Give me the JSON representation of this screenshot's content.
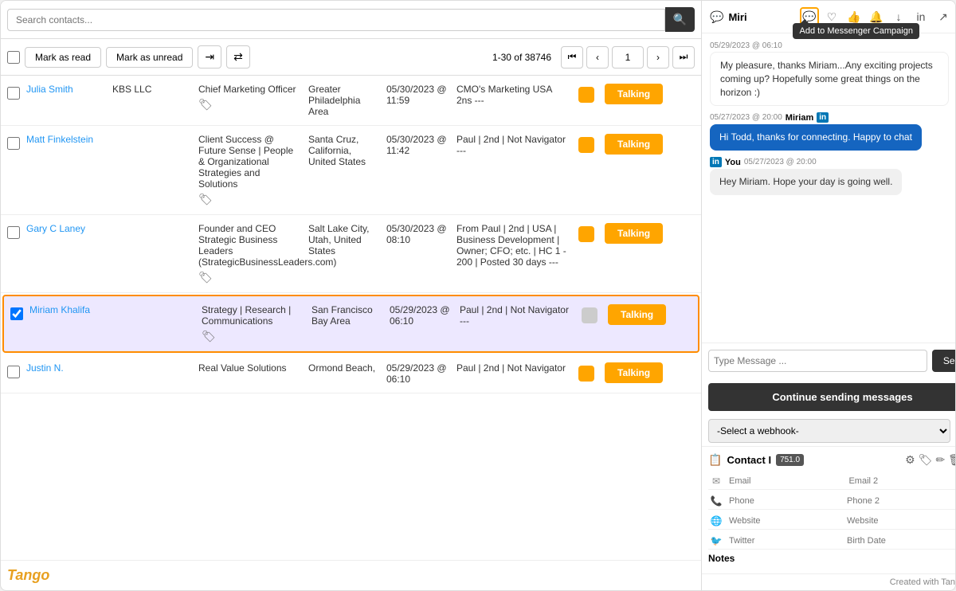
{
  "search": {
    "placeholder": "Search contacts...",
    "value": ""
  },
  "toolbar": {
    "mark_read": "Mark as read",
    "mark_unread": "Mark as unread",
    "pagination_info": "1-30 of 38746",
    "page_current": "1"
  },
  "contacts": [
    {
      "name": "Julia Smith",
      "company": "KBS LLC",
      "title": "Chief Marketing Officer",
      "location": "Greater Philadelphia Area",
      "date": "05/30/2023 @ 11:59",
      "message": "CMO's Marketing USA 2ns ---",
      "status": "orange",
      "action": "Talking",
      "tag": true,
      "selected": false
    },
    {
      "name": "Matt Finkelstein",
      "company": "",
      "title": "Client Success @ Future Sense | People & Organizational Strategies and Solutions",
      "location": "Santa Cruz, California, United States",
      "date": "05/30/2023 @ 11:42",
      "message": "Paul | 2nd | Not Navigator ---",
      "status": "orange",
      "action": "Talking",
      "tag": true,
      "selected": false
    },
    {
      "name": "Gary C Laney",
      "company": "",
      "title": "Founder and CEO Strategic Business Leaders (StrategicBusinessLeaders.com)",
      "location": "Salt Lake City, Utah, United States",
      "date": "05/30/2023 @ 08:10",
      "message": "From Paul | 2nd | USA | Business Development | Owner; CFO; etc. | HC 1 - 200 | Posted 30 days ---",
      "status": "orange",
      "action": "Talking",
      "tag": true,
      "selected": false
    },
    {
      "name": "Miriam Khalifa",
      "company": "",
      "title": "Strategy | Research | Communications",
      "location": "San Francisco Bay Area",
      "date": "05/29/2023 @ 06:10",
      "message": "Paul | 2nd | Not Navigator ---",
      "status": "grey",
      "action": "Talking",
      "tag": true,
      "selected": true
    },
    {
      "name": "Justin N.",
      "company": "",
      "title": "Real Value Solutions",
      "location": "Ormond Beach,",
      "date": "05/29/2023 @ 06:10",
      "message": "Paul | 2nd | Not Navigator",
      "status": "orange",
      "action": "Talking",
      "tag": false,
      "selected": false
    }
  ],
  "chat": {
    "title": "Miri",
    "add_campaign_tooltip": "Add to Messenger Campaign",
    "messages": [
      {
        "type": "received",
        "date": "05/29/2023 @ 06:10",
        "text": "My pleasure, thanks Miriam...Any exciting projects coming up? Hopefully some great things on the horizon :)"
      },
      {
        "type": "sent-linkedin",
        "date": "05/27/2023 @ 20:00",
        "sender": "Miriam",
        "text": "Hi Todd, thanks for connecting. Happy to chat"
      },
      {
        "type": "sent-you",
        "date": "05/27/2023 @ 20:00",
        "sender": "You",
        "text": "Hey Miriam. Hope your day is going well."
      }
    ],
    "input_placeholder": "Type Message ...",
    "send_label": "Send",
    "continue_btn": "Continue sending messages",
    "webhook_placeholder": "-Select a webhook-"
  },
  "contact_panel": {
    "title": "Contact I",
    "badge": "751.0",
    "fields": [
      {
        "icon": "✉",
        "placeholder": "Email",
        "placeholder2": "Email 2"
      },
      {
        "icon": "📞",
        "placeholder": "Phone",
        "placeholder2": "Phone 2"
      },
      {
        "icon": "🌐",
        "placeholder": "Website",
        "placeholder2": "Website"
      },
      {
        "icon": "🐦",
        "placeholder": "Twitter",
        "placeholder2": "Birth Date"
      }
    ],
    "notes_label": "Notes"
  },
  "footer": {
    "brand": "Tango",
    "created_with": "Created with Tango.us"
  }
}
